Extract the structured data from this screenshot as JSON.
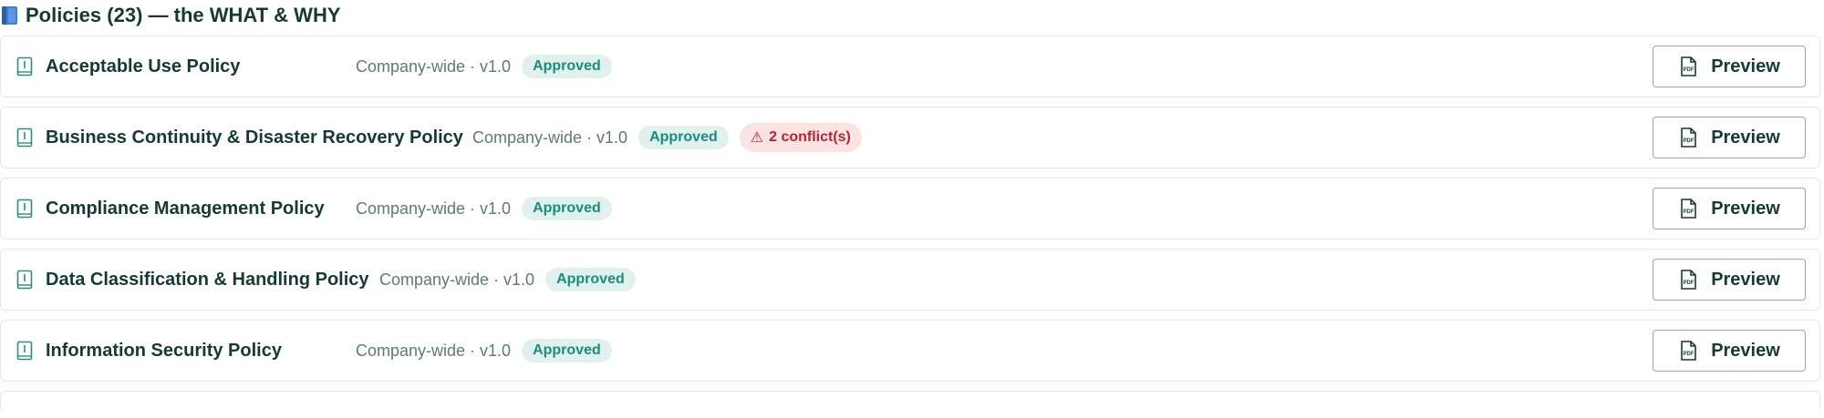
{
  "header": {
    "icon": "blue-book-icon",
    "title": "Policies (23) — the WHAT & WHY"
  },
  "colors": {
    "approved_text": "#1b8c7c",
    "approved_bg": "#e0f1ee",
    "conflict_text": "#b4232f",
    "conflict_bg": "#fbe3e4",
    "title_text": "#163a33",
    "meta_text": "#5f7a74"
  },
  "policies": [
    {
      "name": "Acceptable Use Policy",
      "meta": "Company-wide · v1.0",
      "status": "Approved",
      "conflict": "",
      "action": "Preview"
    },
    {
      "name": "Business Continuity & Disaster Recovery Policy",
      "meta": "Company-wide · v1.0",
      "status": "Approved",
      "conflict": "2 conflict(s)",
      "conflict_icon": "⚠",
      "action": "Preview"
    },
    {
      "name": "Compliance Management Policy",
      "meta": "Company-wide · v1.0",
      "status": "Approved",
      "conflict": "",
      "action": "Preview"
    },
    {
      "name": "Data Classification & Handling Policy",
      "meta": "Company-wide · v1.0",
      "status": "Approved",
      "conflict": "",
      "action": "Preview"
    },
    {
      "name": "Information Security Policy",
      "meta": "Company-wide · v1.0",
      "status": "Approved",
      "conflict": "",
      "action": "Preview"
    }
  ]
}
